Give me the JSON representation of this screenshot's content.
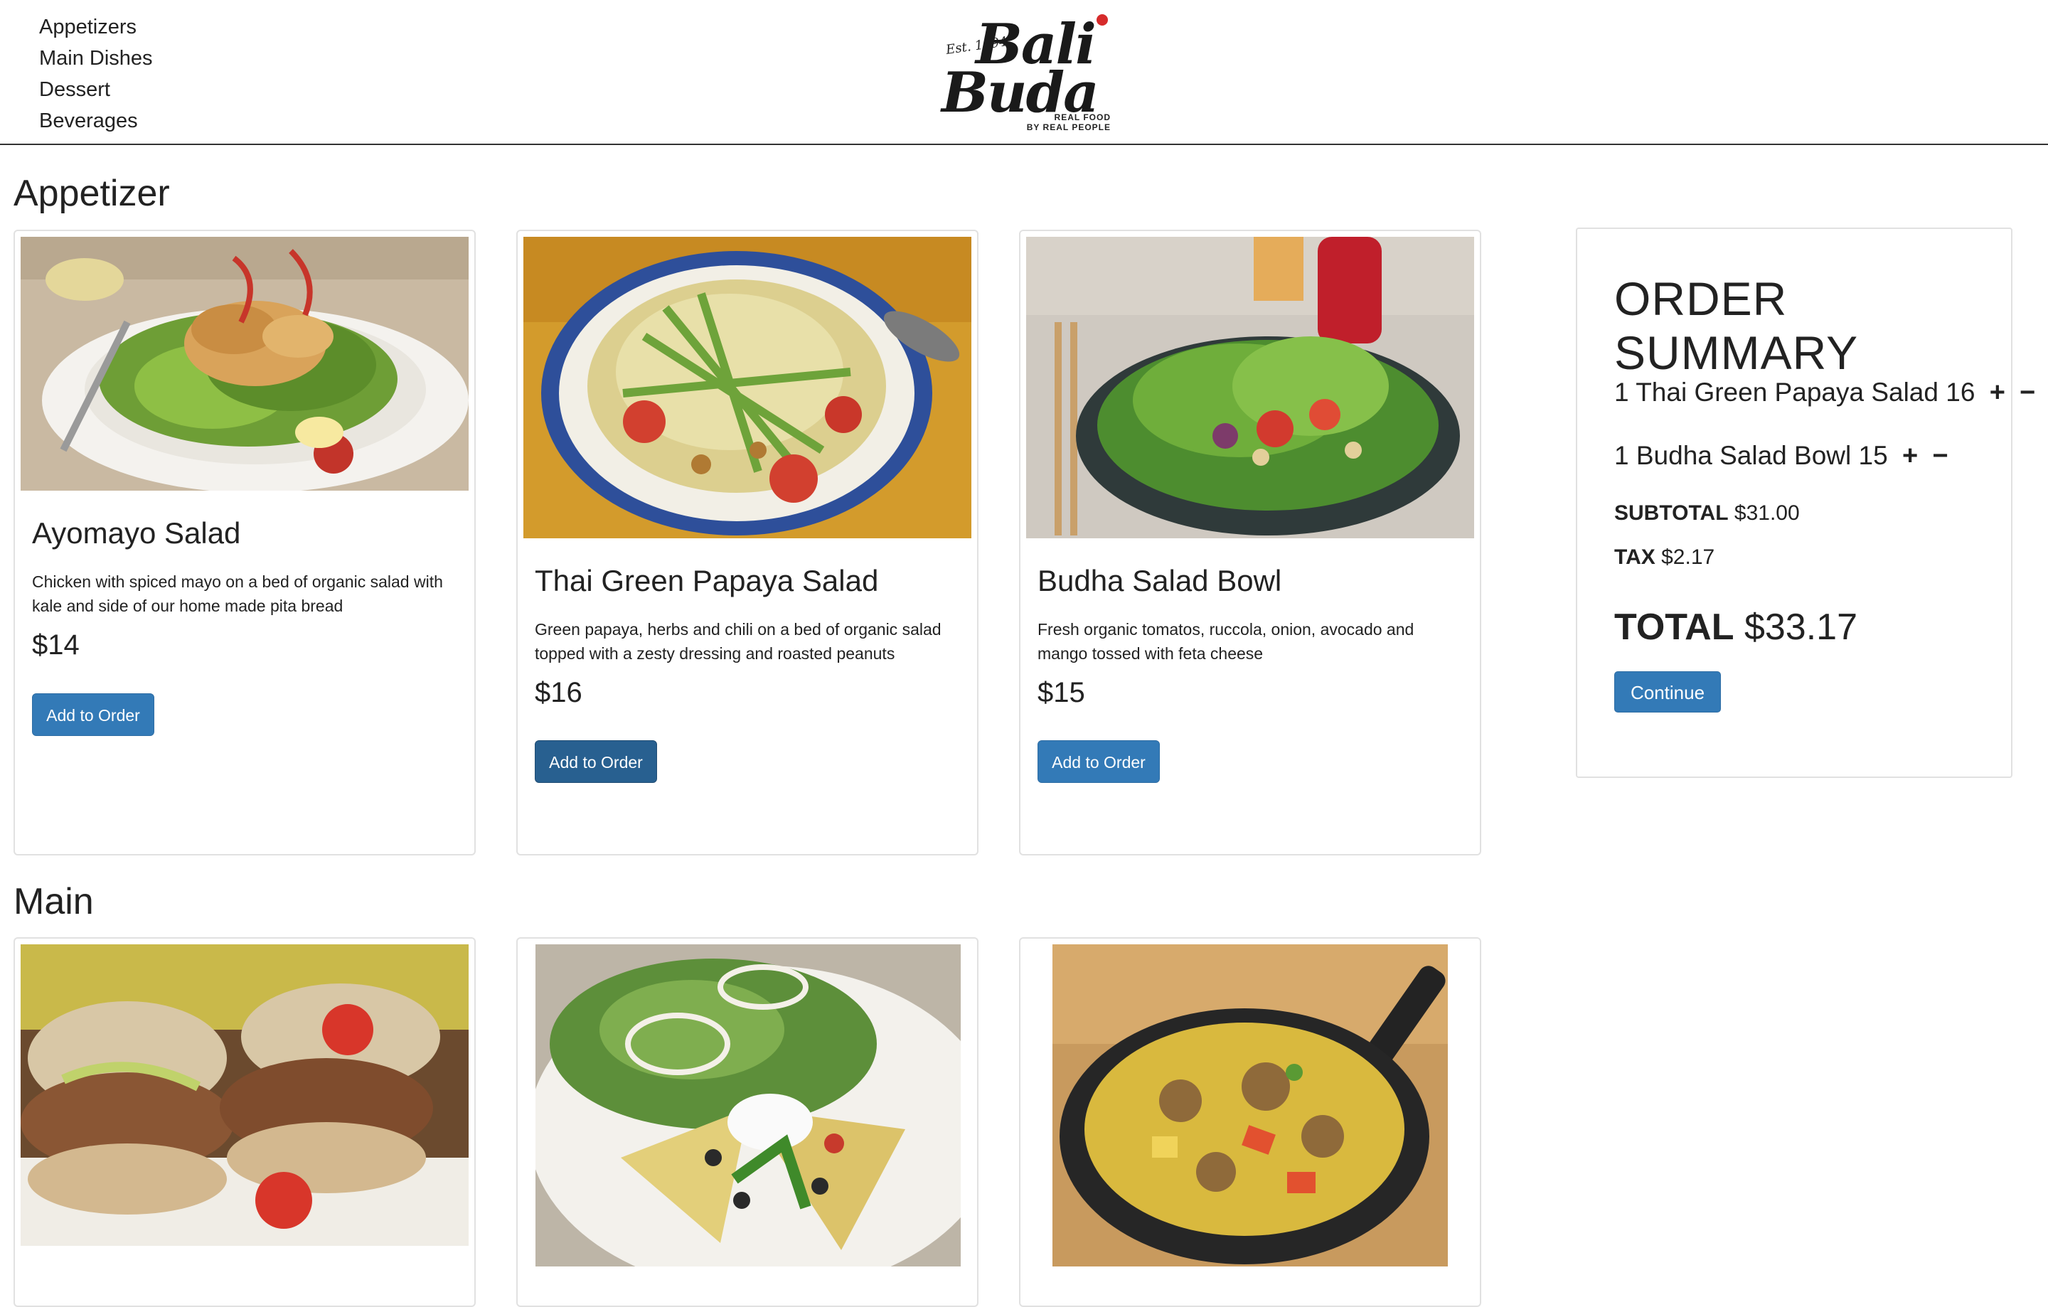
{
  "nav": {
    "items": [
      {
        "label": "Appetizers"
      },
      {
        "label": "Main Dishes"
      },
      {
        "label": "Dessert"
      },
      {
        "label": "Beverages"
      }
    ]
  },
  "logo": {
    "est": "Est. 1994",
    "word1": "Bali",
    "word2": "Buda",
    "tagline1": "REAL FOOD",
    "tagline2": "BY REAL PEOPLE"
  },
  "sections": [
    {
      "title": "Appetizer",
      "items": [
        {
          "name": "Ayomayo Salad",
          "desc": "Chicken with spiced mayo on a bed of organic salad with kale and side of our home made pita bread",
          "price": "$14",
          "button": "Add to Order"
        },
        {
          "name": "Thai Green Papaya Salad",
          "desc": "Green papaya, herbs and chili on a bed of organic salad topped with a zesty dressing and roasted peanuts",
          "price": "$16",
          "button": "Add to Order"
        },
        {
          "name": "Budha Salad Bowl",
          "desc": "Fresh organic tomatos, ruccola, onion, avocado and mango tossed with feta cheese",
          "price": "$15",
          "button": "Add to Order"
        }
      ]
    },
    {
      "title": "Main"
    }
  ],
  "summary": {
    "title": "ORDER SUMMARY",
    "items": [
      {
        "text": "1 Thai Green Papaya Salad 16",
        "plus": "+",
        "minus": "−"
      },
      {
        "text": "1 Budha Salad Bowl 15",
        "plus": "+",
        "minus": "−"
      }
    ],
    "subtotal_label": "SUBTOTAL",
    "subtotal_value": "$31.00",
    "tax_label": "TAX",
    "tax_value": "$2.17",
    "total_label": "TOTAL",
    "total_value": "$33.17",
    "continue": "Continue"
  },
  "colors": {
    "primary_button": "#337ab7",
    "primary_button_active": "#286090",
    "logo_dot": "#d62b2b"
  }
}
